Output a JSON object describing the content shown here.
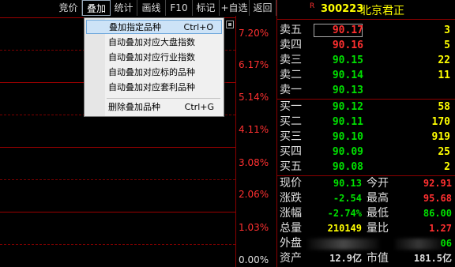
{
  "toolbar": {
    "items": [
      "竞价",
      "叠加",
      "统计",
      "画线",
      "F10",
      "标记",
      "+自选",
      "返回"
    ],
    "active": "叠加"
  },
  "chart": {
    "percent_labels": [
      "7.20%",
      "6.17%",
      "5.14%",
      "4.11%",
      "3.08%",
      "2.06%",
      "1.03%",
      "0.00%"
    ]
  },
  "menu": {
    "items": [
      {
        "label": "叠加指定品种",
        "shortcut": "Ctrl+O"
      },
      {
        "label": "自动叠加对应大盘指数",
        "shortcut": ""
      },
      {
        "label": "自动叠加对应行业指数",
        "shortcut": ""
      },
      {
        "label": "自动叠加对应标的品种",
        "shortcut": ""
      },
      {
        "label": "自动叠加对应套利品种",
        "shortcut": ""
      },
      {
        "label": "删除叠加品种",
        "shortcut": "Ctrl+G"
      }
    ]
  },
  "quote": {
    "tag": "R",
    "code": "300223",
    "name": "北京君正",
    "sells": [
      {
        "label": "卖五",
        "price": "90.17",
        "vol": "3"
      },
      {
        "label": "卖四",
        "price": "90.16",
        "vol": "5"
      },
      {
        "label": "卖三",
        "price": "90.15",
        "vol": "22"
      },
      {
        "label": "卖二",
        "price": "90.14",
        "vol": "11"
      },
      {
        "label": "卖一",
        "price": "90.13",
        "vol": ""
      }
    ],
    "buys": [
      {
        "label": "买一",
        "price": "90.12",
        "vol": "58"
      },
      {
        "label": "买二",
        "price": "90.11",
        "vol": "170"
      },
      {
        "label": "买三",
        "price": "90.10",
        "vol": "919"
      },
      {
        "label": "买四",
        "price": "90.09",
        "vol": "25"
      },
      {
        "label": "买五",
        "price": "90.08",
        "vol": "2"
      }
    ],
    "stats": [
      {
        "l1": "现价",
        "v1": "90.13",
        "l2": "今开",
        "v2": "92.91"
      },
      {
        "l1": "涨跌",
        "v1": "-2.54",
        "l2": "最高",
        "v2": "95.68"
      },
      {
        "l1": "涨幅",
        "v1": "-2.74%",
        "l2": "最低",
        "v2": "86.00"
      },
      {
        "l1": "总量",
        "v1": "210149",
        "l2": "量比",
        "v2": "1.27"
      },
      {
        "l1": "外盘",
        "v1": "",
        "l2": "",
        "v2": "06"
      },
      {
        "l1": "资产",
        "v1": "12.9亿",
        "l2": "市值",
        "v2": "181.5亿"
      }
    ]
  },
  "colors": {
    "up": "#ff3030",
    "down": "#00e000",
    "volume": "#ffff00",
    "grid": "#8b0000"
  }
}
